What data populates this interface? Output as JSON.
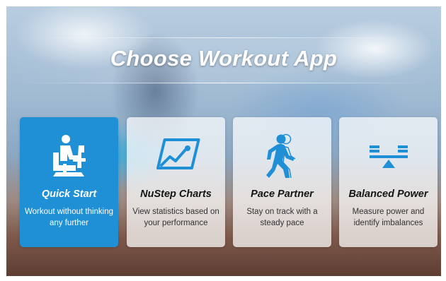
{
  "header": {
    "title": "Choose Workout App"
  },
  "colors": {
    "accent": "#1f8fd6",
    "card": "rgba(255,255,255,0.72)"
  },
  "apps": [
    {
      "name": "Quick Start",
      "description": "Workout without thinking any further",
      "icon": "person-on-stepper-icon",
      "selected": true
    },
    {
      "name": "NuStep Charts",
      "description": "View statistics based on your performance",
      "icon": "line-chart-icon",
      "selected": false
    },
    {
      "name": "Pace Partner",
      "description": "Stay on track with a steady pace",
      "icon": "walking-person-icon",
      "selected": false
    },
    {
      "name": "Balanced Power",
      "description": "Measure power and identify imbalances",
      "icon": "balance-scale-icon",
      "selected": false
    }
  ]
}
